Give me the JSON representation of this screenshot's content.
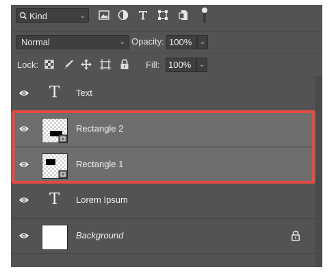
{
  "panel": {
    "filter": {
      "kind_label": "Kind",
      "icons": [
        "pixel-filter-icon",
        "adjustment-filter-icon",
        "type-filter-icon",
        "shape-filter-icon",
        "smart-object-filter-icon"
      ]
    },
    "blend": {
      "mode": "Normal",
      "opacity_label": "Opacity:",
      "opacity_value": "100%"
    },
    "lock": {
      "label": "Lock:",
      "fill_label": "Fill:",
      "fill_value": "100%"
    },
    "layers": [
      {
        "name": "Text",
        "type": "text",
        "selected": false
      },
      {
        "name": "Rectangle 2",
        "type": "shape",
        "selected": true
      },
      {
        "name": "Rectangle 1",
        "type": "shape",
        "selected": true
      },
      {
        "name": "Lorem Ipsum",
        "type": "text",
        "selected": false
      },
      {
        "name": "Background",
        "type": "background",
        "selected": false,
        "locked": true
      }
    ]
  },
  "colors": {
    "panel": "#535353",
    "selected_row": "#6e6e6e",
    "highlight": "#e84a41"
  }
}
